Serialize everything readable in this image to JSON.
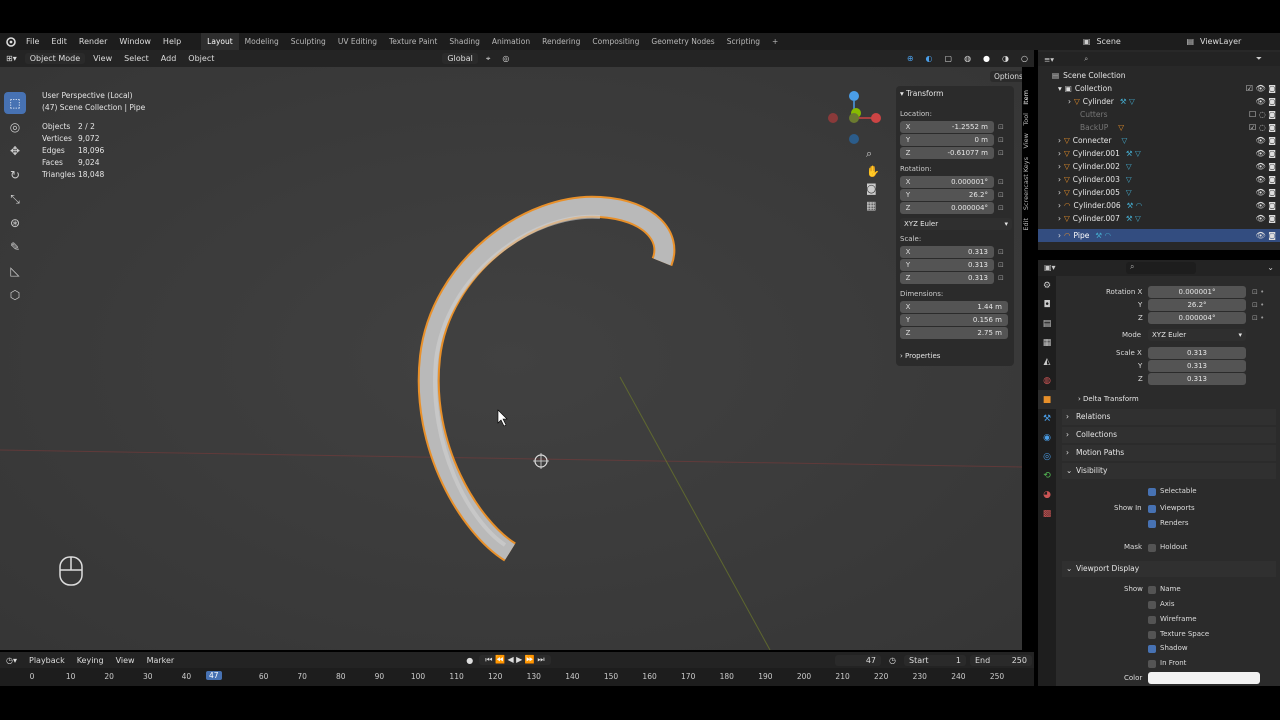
{
  "menu": {
    "file": "File",
    "edit": "Edit",
    "render": "Render",
    "window": "Window",
    "help": "Help"
  },
  "workspaces": [
    "Layout",
    "Modeling",
    "Sculpting",
    "UV Editing",
    "Texture Paint",
    "Shading",
    "Animation",
    "Rendering",
    "Compositing",
    "Geometry Nodes",
    "Scripting"
  ],
  "active_workspace": "Layout",
  "scene": {
    "name": "Scene",
    "view_layer": "ViewLayer"
  },
  "viewport": {
    "mode": "Object Mode",
    "view": "View",
    "select": "Select",
    "add": "Add",
    "object": "Object",
    "orientation": "Global",
    "options": "Options",
    "overlay_title": "User Perspective (Local)",
    "overlay_sub": "(47) Scene Collection | Pipe"
  },
  "stats": [
    {
      "k": "Objects",
      "v": "2 / 2"
    },
    {
      "k": "Vertices",
      "v": "9,072"
    },
    {
      "k": "Edges",
      "v": "18,096"
    },
    {
      "k": "Faces",
      "v": "9,024"
    },
    {
      "k": "Triangles",
      "v": "18,048"
    }
  ],
  "npanel": {
    "title": "Transform",
    "location_label": "Location:",
    "location": {
      "x": "-1.2552 m",
      "y": "0 m",
      "z": "-0.61077 m"
    },
    "rotation_label": "Rotation:",
    "rotation": {
      "x": "0.000001°",
      "y": "26.2°",
      "z": "0.000004°"
    },
    "rotation_mode": "XYZ Euler",
    "scale_label": "Scale:",
    "scale": {
      "x": "0.313",
      "y": "0.313",
      "z": "0.313"
    },
    "dimensions_label": "Dimensions:",
    "dimensions": {
      "x": "1.44 m",
      "y": "0.156 m",
      "z": "2.75 m"
    },
    "properties": "Properties",
    "axes": {
      "x": "X",
      "y": "Y",
      "z": "Z"
    }
  },
  "ntabs": [
    "Item",
    "Tool",
    "View",
    "Screencast Keys",
    "Edit"
  ],
  "outliner": {
    "root": "Scene Collection",
    "rows": [
      {
        "name": "Collection"
      },
      {
        "name": "Cylinder"
      },
      {
        "name": "Cutters"
      },
      {
        "name": "BackUP"
      },
      {
        "name": "Connecter"
      },
      {
        "name": "Cylinder.001"
      },
      {
        "name": "Cylinder.002"
      },
      {
        "name": "Cylinder.003"
      },
      {
        "name": "Cylinder.005"
      },
      {
        "name": "Cylinder.006"
      },
      {
        "name": "Cylinder.007"
      },
      {
        "name": "Pipe"
      }
    ]
  },
  "props": {
    "rotation_x_label": "Rotation X",
    "y": "Y",
    "z": "Z",
    "rotation": {
      "x": "0.000001°",
      "y": "26.2°",
      "z": "0.000004°"
    },
    "mode_label": "Mode",
    "mode": "XYZ Euler",
    "scale_x_label": "Scale X",
    "scale": {
      "x": "0.313",
      "y": "0.313",
      "z": "0.313"
    },
    "delta": "Delta Transform",
    "relations": "Relations",
    "collections": "Collections",
    "motion_paths": "Motion Paths",
    "visibility": "Visibility",
    "selectable": "Selectable",
    "show_in": "Show In",
    "viewports": "Viewports",
    "renders": "Renders",
    "mask": "Mask",
    "holdout": "Holdout",
    "viewport_display": "Viewport Display",
    "show": "Show",
    "name": "Name",
    "axis": "Axis",
    "wireframe": "Wireframe",
    "texture_space": "Texture Space",
    "shadow": "Shadow",
    "in_front": "In Front",
    "color": "Color"
  },
  "timeline": {
    "playback": "Playback",
    "keying": "Keying",
    "view": "View",
    "marker": "Marker",
    "current": "47",
    "start_label": "Start",
    "start": "1",
    "end_label": "End",
    "end": "250",
    "frame_badge": "47",
    "ticks": [
      "0",
      "10",
      "20",
      "30",
      "40",
      "60",
      "70",
      "80",
      "90",
      "100",
      "110",
      "120",
      "130",
      "140",
      "150",
      "160",
      "170",
      "180",
      "190",
      "200",
      "210",
      "220",
      "230",
      "240",
      "250"
    ]
  },
  "colors": {
    "accent": "#4772b3",
    "selection_outline": "#e8902a",
    "x_axis": "#c44",
    "y_axis": "#8b0",
    "z_axis": "#4a9ee8"
  }
}
